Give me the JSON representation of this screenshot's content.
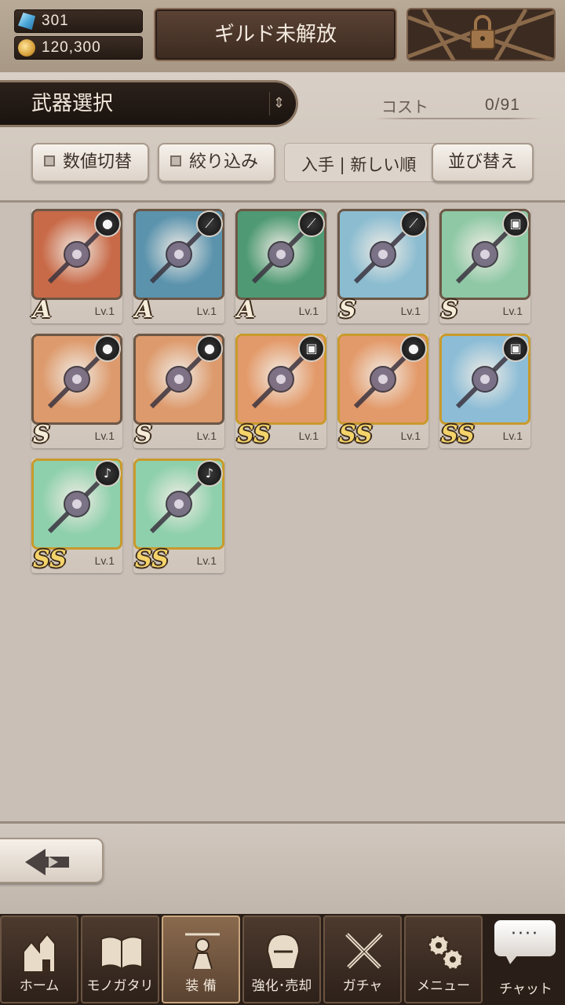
{
  "currency": {
    "gems": "301",
    "gold": "120,300",
    "gem_icon": "crystal-icon",
    "gold_icon": "coin-icon"
  },
  "guild_button": {
    "label": "ギルド未解放"
  },
  "locked_button": {
    "icon": "chain-lock-icon"
  },
  "header": {
    "title": "武器選択",
    "cost_label": "コスト",
    "cost_value": "0/91"
  },
  "toolbar": {
    "toggle_values_label": "数値切替",
    "filter_label": "絞り込み",
    "sort_current": "入手 | 新しい順",
    "sort_button_label": "並び替え"
  },
  "weapons": [
    {
      "rank": "A",
      "level": "Lv.1",
      "type_icon": "orb-icon",
      "bg": "#c86a48"
    },
    {
      "rank": "A",
      "level": "Lv.1",
      "type_icon": "staff-icon",
      "bg": "#5b93ad"
    },
    {
      "rank": "A",
      "level": "Lv.1",
      "type_icon": "staff-icon",
      "bg": "#4f9a74"
    },
    {
      "rank": "S",
      "level": "Lv.1",
      "type_icon": "staff-icon",
      "bg": "#8bbcd0"
    },
    {
      "rank": "S",
      "level": "Lv.1",
      "type_icon": "book-icon",
      "bg": "#8ec8a4"
    },
    {
      "rank": "S",
      "level": "Lv.1",
      "type_icon": "orb-icon",
      "bg": "#dd9a6c"
    },
    {
      "rank": "S",
      "level": "Lv.1",
      "type_icon": "orb-icon",
      "bg": "#dd9a6c"
    },
    {
      "rank": "SS",
      "level": "Lv.1",
      "type_icon": "book-icon",
      "bg": "#e39a6a"
    },
    {
      "rank": "SS",
      "level": "Lv.1",
      "type_icon": "orb-icon",
      "bg": "#e39a6a"
    },
    {
      "rank": "SS",
      "level": "Lv.1",
      "type_icon": "book-icon",
      "bg": "#8dbdd6"
    },
    {
      "rank": "SS",
      "level": "Lv.1",
      "type_icon": "harp-icon",
      "bg": "#8fd0ac"
    },
    {
      "rank": "SS",
      "level": "Lv.1",
      "type_icon": "harp-icon",
      "bg": "#8fd0ac"
    }
  ],
  "nav": {
    "home": "ホーム",
    "story": "モノガタリ",
    "equip": "装 備",
    "enhance": "強化･売却",
    "gacha": "ガチャ",
    "menu": "メニュー",
    "chat": "チャット",
    "chat_bubble": "····"
  }
}
